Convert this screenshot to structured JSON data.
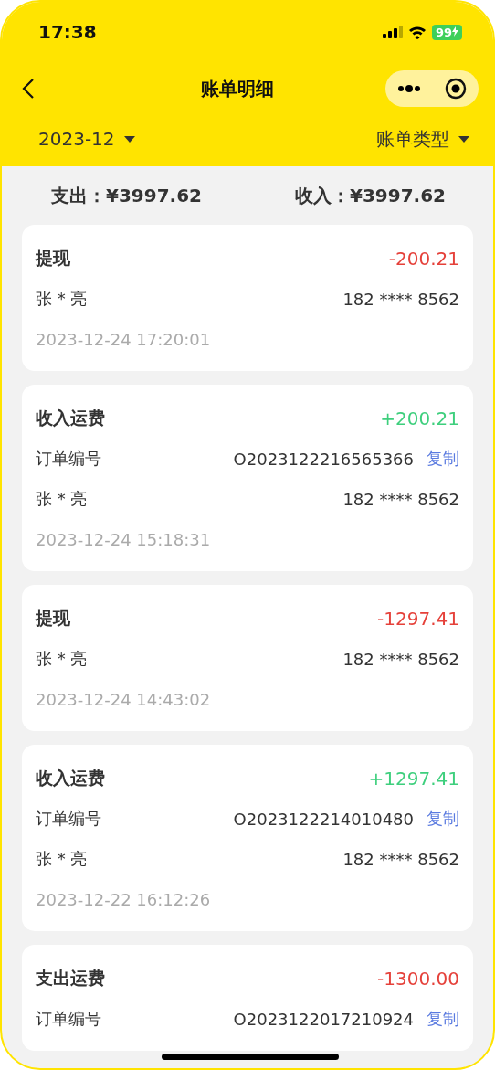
{
  "status_bar": {
    "time": "17:38",
    "battery": "99"
  },
  "nav": {
    "title": "账单明细"
  },
  "filters": {
    "month": "2023-12",
    "type": "账单类型"
  },
  "summary": {
    "expense": "支出：¥3997.62",
    "income": "收入：¥3997.62"
  },
  "records": [
    {
      "title": "提现",
      "amount": "-200.21",
      "kind": "out",
      "name": "张 * 亮",
      "phone": "182 **** 8562",
      "time": "2023-12-24 17:20:01"
    },
    {
      "title": "收入运费",
      "amount": "+200.21",
      "kind": "in",
      "order_label": "订单编号",
      "order_no": "O2023122216565366",
      "copy": "复制",
      "name": "张 * 亮",
      "phone": "182 **** 8562",
      "time": "2023-12-24 15:18:31"
    },
    {
      "title": "提现",
      "amount": "-1297.41",
      "kind": "out",
      "name": "张 * 亮",
      "phone": "182 **** 8562",
      "time": "2023-12-24 14:43:02"
    },
    {
      "title": "收入运费",
      "amount": "+1297.41",
      "kind": "in",
      "order_label": "订单编号",
      "order_no": "O2023122214010480",
      "copy": "复制",
      "name": "张 * 亮",
      "phone": "182 **** 8562",
      "time": "2023-12-22 16:12:26"
    },
    {
      "title": "支出运费",
      "amount": "-1300.00",
      "kind": "out",
      "order_label": "订单编号",
      "order_no": "O2023122017210924",
      "copy": "复制"
    }
  ]
}
